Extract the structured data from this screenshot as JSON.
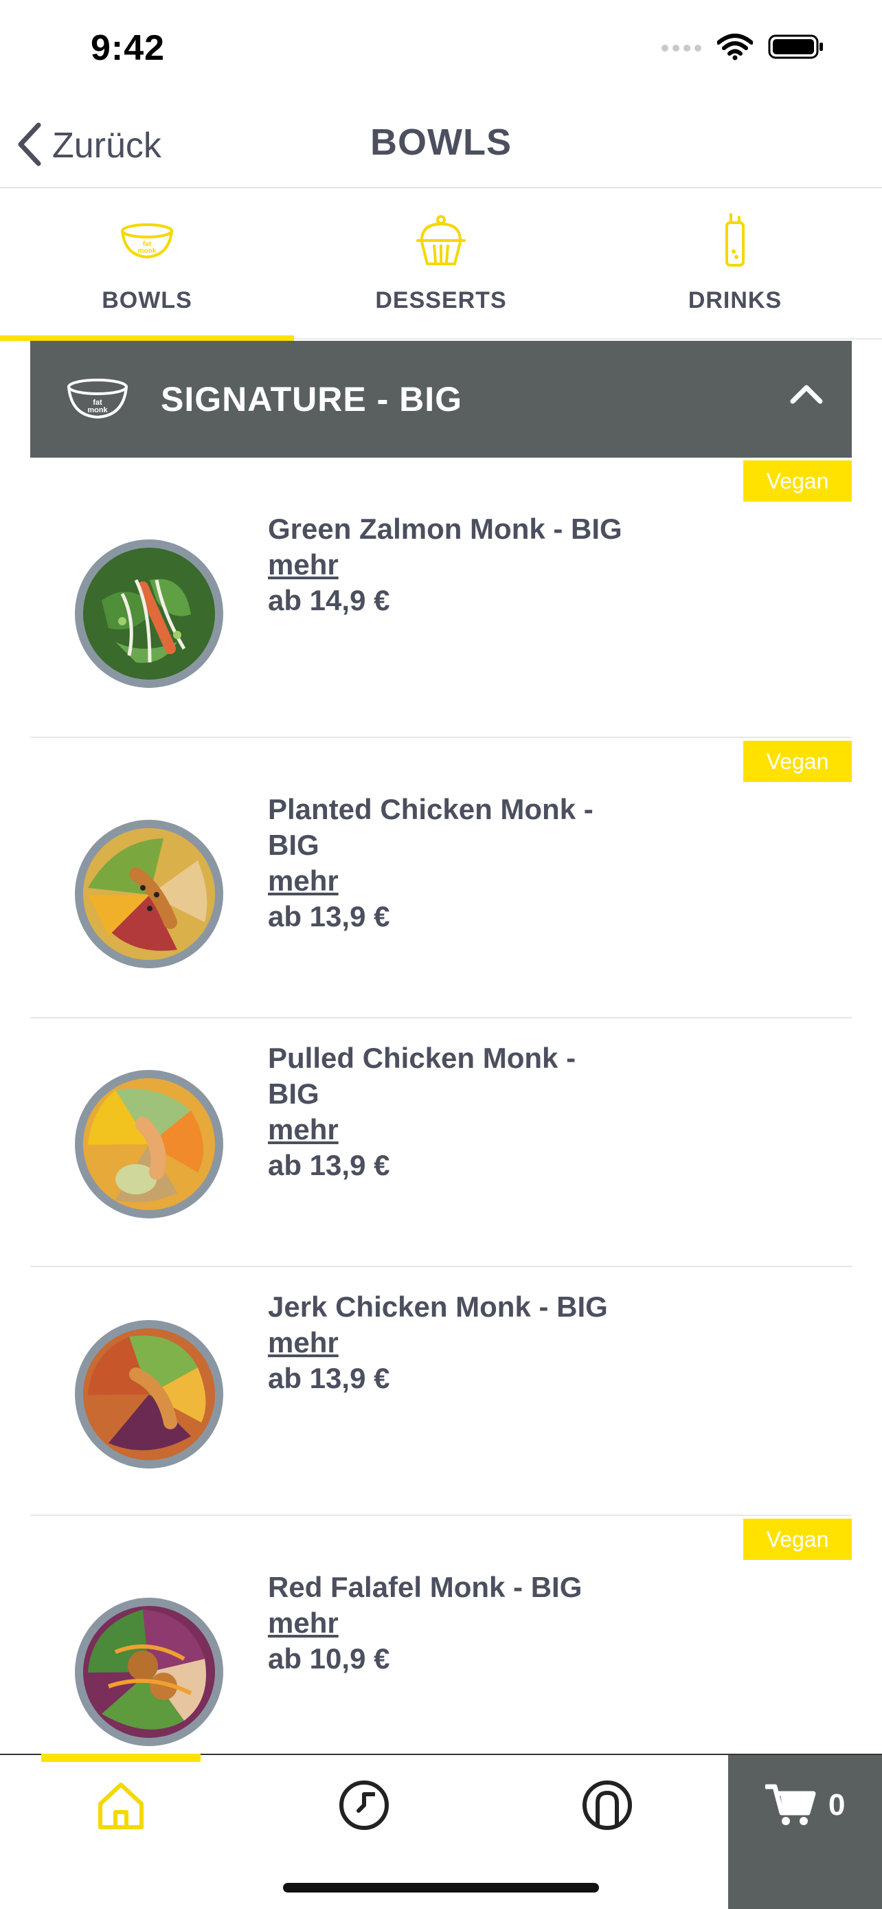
{
  "status": {
    "time": "9:42"
  },
  "nav": {
    "back_label": "Zurück",
    "title": "BOWLS"
  },
  "tabs": [
    {
      "label": "BOWLS",
      "icon": "bowl-icon",
      "active": true
    },
    {
      "label": "DESSERTS",
      "icon": "cupcake-icon",
      "active": false
    },
    {
      "label": "DRINKS",
      "icon": "bottle-icon",
      "active": false
    }
  ],
  "section": {
    "title": "SIGNATURE - BIG",
    "icon": "bowl-icon",
    "expanded": true
  },
  "products": [
    {
      "name": "Green Zalmon Monk - BIG",
      "more": "mehr",
      "price": "ab 14,9 €",
      "badge": "Vegan",
      "icon": "green-bowl-image"
    },
    {
      "name": "Planted Chicken Monk - BIG",
      "more": "mehr",
      "price": "ab 13,9 €",
      "badge": "Vegan",
      "icon": "planted-chicken-bowl-image"
    },
    {
      "name": "Pulled Chicken Monk - BIG",
      "more": "mehr",
      "price": "ab 13,9 €",
      "badge": "",
      "icon": "pulled-chicken-bowl-image"
    },
    {
      "name": "Jerk Chicken Monk - BIG",
      "more": "mehr",
      "price": "ab 13,9 €",
      "badge": "",
      "icon": "jerk-chicken-bowl-image"
    },
    {
      "name": "Red Falafel Monk - BIG",
      "more": "mehr",
      "price": "ab 10,9 €",
      "badge": "Vegan",
      "icon": "red-falafel-bowl-image"
    }
  ],
  "bottom_nav": {
    "items": [
      {
        "icon": "home-icon",
        "active": true
      },
      {
        "icon": "history-icon",
        "active": false
      },
      {
        "icon": "profile-icon",
        "active": false
      }
    ],
    "cart_count": "0"
  },
  "colors": {
    "accent": "#ffe200",
    "header_bg": "#5a6060",
    "text": "#4b4f5e"
  }
}
